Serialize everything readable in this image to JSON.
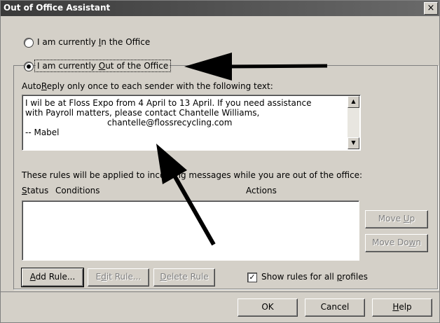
{
  "window": {
    "title": "Out of Office Assistant",
    "close_glyph": "×"
  },
  "options": {
    "in_office_label_pre": "I am currently ",
    "in_office_label_accel": "I",
    "in_office_label_post": "n the Office",
    "out_office_label_pre": "I am currently ",
    "out_office_label_accel": "O",
    "out_office_label_post": "ut of the Office",
    "selected": "out"
  },
  "autoreply": {
    "label_pre": "Auto",
    "label_accel": "R",
    "label_post": "eply only once to each sender with the following text:",
    "lines": [
      "I wil be at Floss Expo from 4 April to 13 April.  If you need assistance",
      "with Payroll matters, please contact Chantelle Williams,",
      "chantelle@flossrecycling.com",
      "-- Mabel"
    ]
  },
  "rules": {
    "intro": "These rules will be applied to incoming messages while you are out of the office:",
    "col_status_accel": "S",
    "col_status_rest": "tatus",
    "col_conditions": "Conditions",
    "col_actions": "Actions",
    "move_up_pre": "Move ",
    "move_up_accel": "U",
    "move_up_post": "p",
    "move_down_pre": "Move Do",
    "move_down_accel": "w",
    "move_down_post": "n",
    "add_rule_accel": "A",
    "add_rule_rest": "dd Rule...",
    "edit_rule_pre": "E",
    "edit_rule_accel": "d",
    "edit_rule_post": "it Rule...",
    "delete_rule_accel": "D",
    "delete_rule_rest": "elete Rule",
    "show_all_pre": "Show rules for all ",
    "show_all_accel": "p",
    "show_all_post": "rofiles",
    "show_all_checked": true
  },
  "footer": {
    "ok": "OK",
    "cancel": "Cancel",
    "help_accel": "H",
    "help_rest": "elp"
  },
  "icons": [
    "close-icon",
    "scroll-up-arrow-icon",
    "scroll-down-arrow-icon",
    "checkmark-icon"
  ],
  "colors": {
    "dialog_bg": "#d4d0c8",
    "title_bar": "#4a4a4a",
    "annotation_arrow": "#000000"
  }
}
